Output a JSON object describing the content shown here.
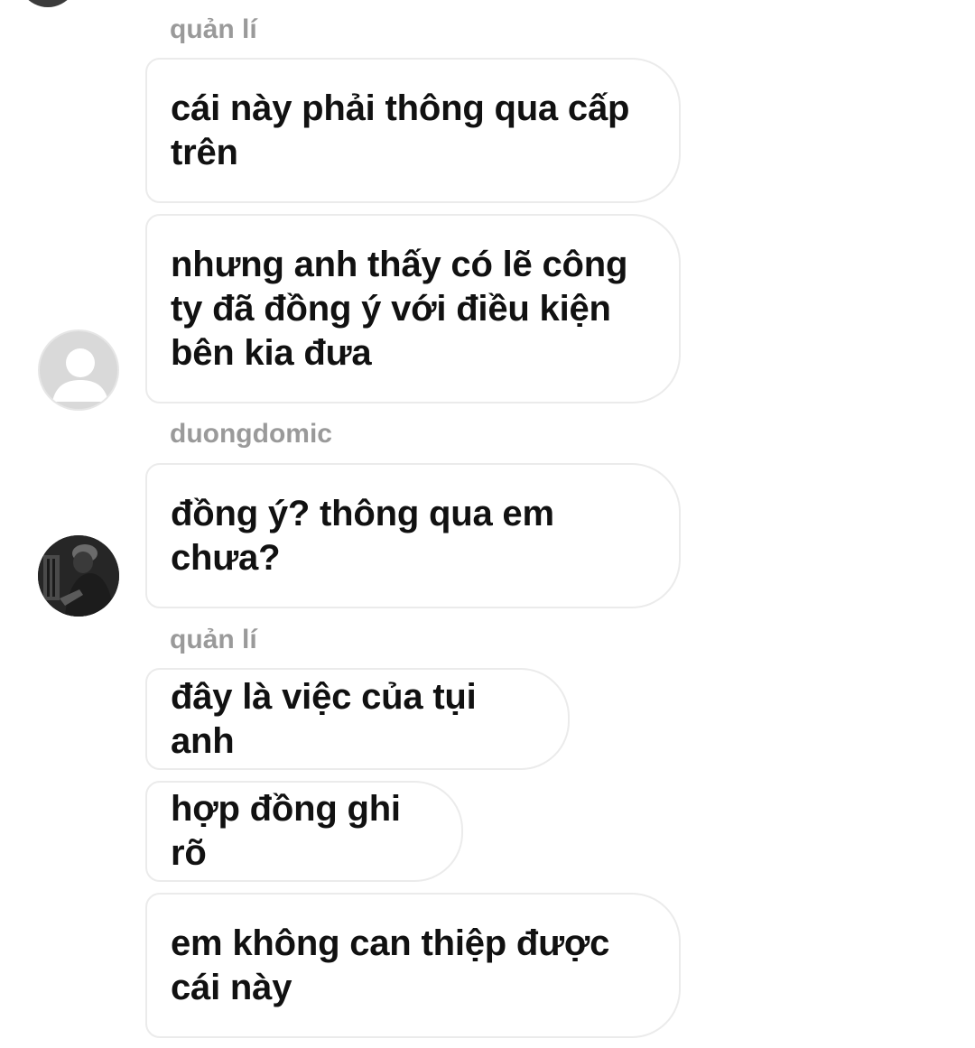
{
  "conversation": {
    "participants": {
      "manager": "quản lí",
      "user": "duongdomic"
    },
    "groups": [
      {
        "sender": "quản lí",
        "messages": [
          "cái này phải thông qua cấp trên",
          "nhưng anh thấy có lẽ công ty đã đồng ý với điều kiện bên kia đưa"
        ]
      },
      {
        "sender": "duongdomic",
        "messages": [
          "đồng ý? thông qua em chưa?"
        ]
      },
      {
        "sender": "quản lí",
        "messages": [
          "đây là việc của tụi anh",
          "hợp đồng ghi rõ",
          "em không can thiệp được cái này"
        ]
      }
    ]
  },
  "colors": {
    "sender_name": "#9a9a9a",
    "bubble_border": "#ebebeb",
    "message_text": "#111111",
    "default_avatar": "#d9d9d9"
  },
  "icons": {
    "default_avatar": "default-user-avatar-icon",
    "user_avatar": "user-photo-avatar"
  }
}
